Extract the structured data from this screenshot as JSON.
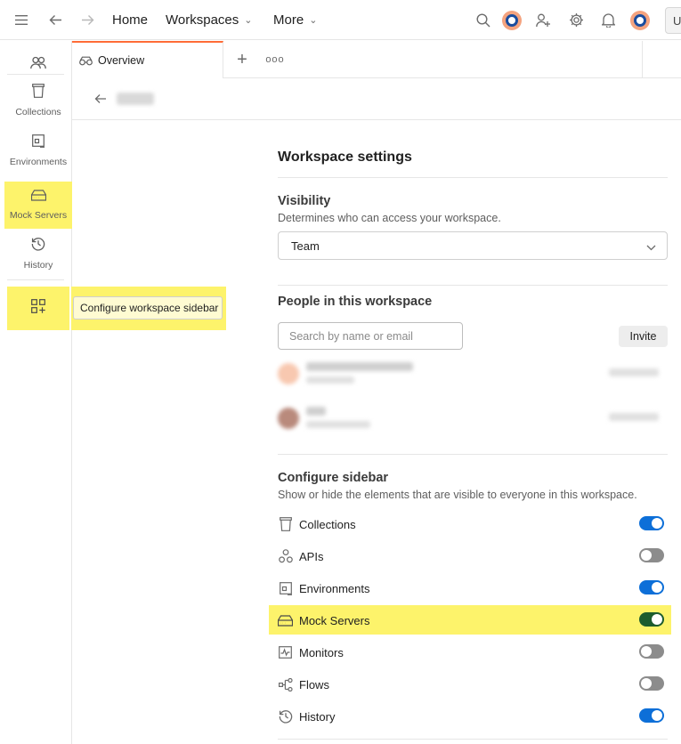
{
  "topbar": {
    "home_label": "Home",
    "workspaces_label": "Workspaces",
    "more_label": "More",
    "upgrade_label": "U"
  },
  "rail": {
    "items": [
      {
        "name": "team",
        "label": "",
        "icon": "people-icon"
      },
      {
        "name": "collections",
        "label": "Collections",
        "icon": "collections-icon"
      },
      {
        "name": "environments",
        "label": "Environments",
        "icon": "environments-icon"
      },
      {
        "name": "mock-servers",
        "label": "Mock Servers",
        "icon": "mock-server-icon",
        "highlighted": true
      },
      {
        "name": "history",
        "label": "History",
        "icon": "history-icon"
      },
      {
        "name": "configure",
        "label": "",
        "icon": "grid-add-icon",
        "highlighted": true
      }
    ]
  },
  "tooltip": {
    "text": "Configure workspace sidebar"
  },
  "tabs": {
    "active_label": "Overview",
    "add_label": "+",
    "more_label": "ooo"
  },
  "settings": {
    "title": "Workspace settings",
    "visibility": {
      "heading": "Visibility",
      "description": "Determines who can access your workspace.",
      "selected": "Team"
    },
    "people": {
      "heading": "People in this workspace",
      "search_placeholder": "Search by name or email",
      "invite_label": "Invite"
    },
    "sidebar": {
      "heading": "Configure sidebar",
      "description": "Show or hide the elements that are visible to everyone in this workspace.",
      "items": [
        {
          "label": "Collections",
          "icon": "collections-icon",
          "enabled": true
        },
        {
          "label": "APIs",
          "icon": "apis-icon",
          "enabled": false
        },
        {
          "label": "Environments",
          "icon": "environments-icon",
          "enabled": true
        },
        {
          "label": "Mock Servers",
          "icon": "mock-server-icon",
          "enabled": true,
          "highlighted": true
        },
        {
          "label": "Monitors",
          "icon": "monitors-icon",
          "enabled": false
        },
        {
          "label": "Flows",
          "icon": "flows-icon",
          "enabled": false
        },
        {
          "label": "History",
          "icon": "history-icon",
          "enabled": true
        }
      ]
    }
  },
  "colors": {
    "accent": "#ff6c37",
    "toggle_on": "#0d6fd8",
    "toggle_on_highlighted": "#1c5c2e",
    "toggle_off": "#8c8c8c",
    "highlight": "#fdf36b"
  }
}
